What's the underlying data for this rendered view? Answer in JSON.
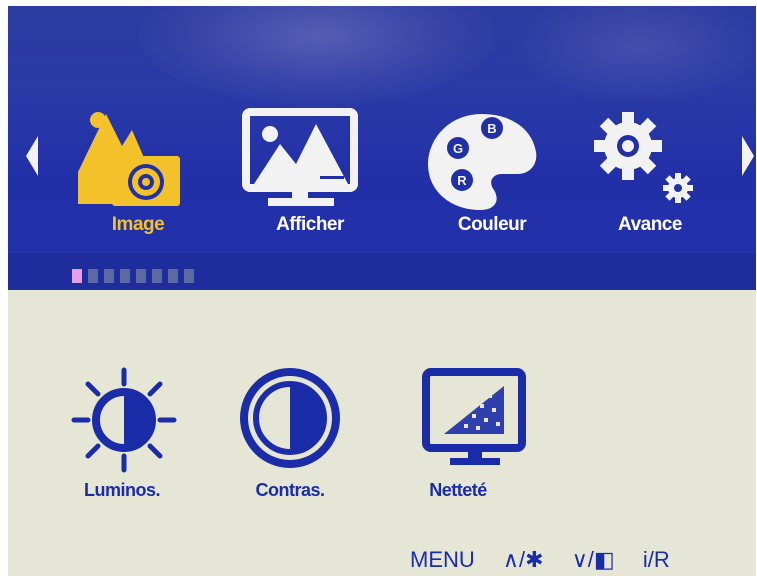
{
  "menu": {
    "categories": [
      {
        "label": "Image",
        "icon": "image-icon",
        "active": true
      },
      {
        "label": "Afficher",
        "icon": "display-icon",
        "active": false
      },
      {
        "label": "Couleur",
        "icon": "palette-icon",
        "active": false
      },
      {
        "label": "Avance",
        "icon": "gears-icon",
        "active": false
      }
    ],
    "palette_letters": [
      "B",
      "G",
      "R"
    ],
    "page_indicator": {
      "total": 8,
      "current": 1
    }
  },
  "submenu": {
    "items": [
      {
        "label": "Luminos.",
        "icon": "brightness-icon"
      },
      {
        "label": "Contras.",
        "icon": "contrast-icon"
      },
      {
        "label": "Netteté",
        "icon": "sharpness-icon"
      }
    ]
  },
  "hints": {
    "menu": "MENU",
    "up": "∧/✱",
    "down": "∨/◧",
    "info": "i/R"
  },
  "colors": {
    "bar_blue": "#2230a8",
    "active_yellow": "#f3c12a",
    "panel_bg": "#e6e6d6",
    "text_blue": "#1b2ca8",
    "indicator_active": "#e6a0e6"
  }
}
